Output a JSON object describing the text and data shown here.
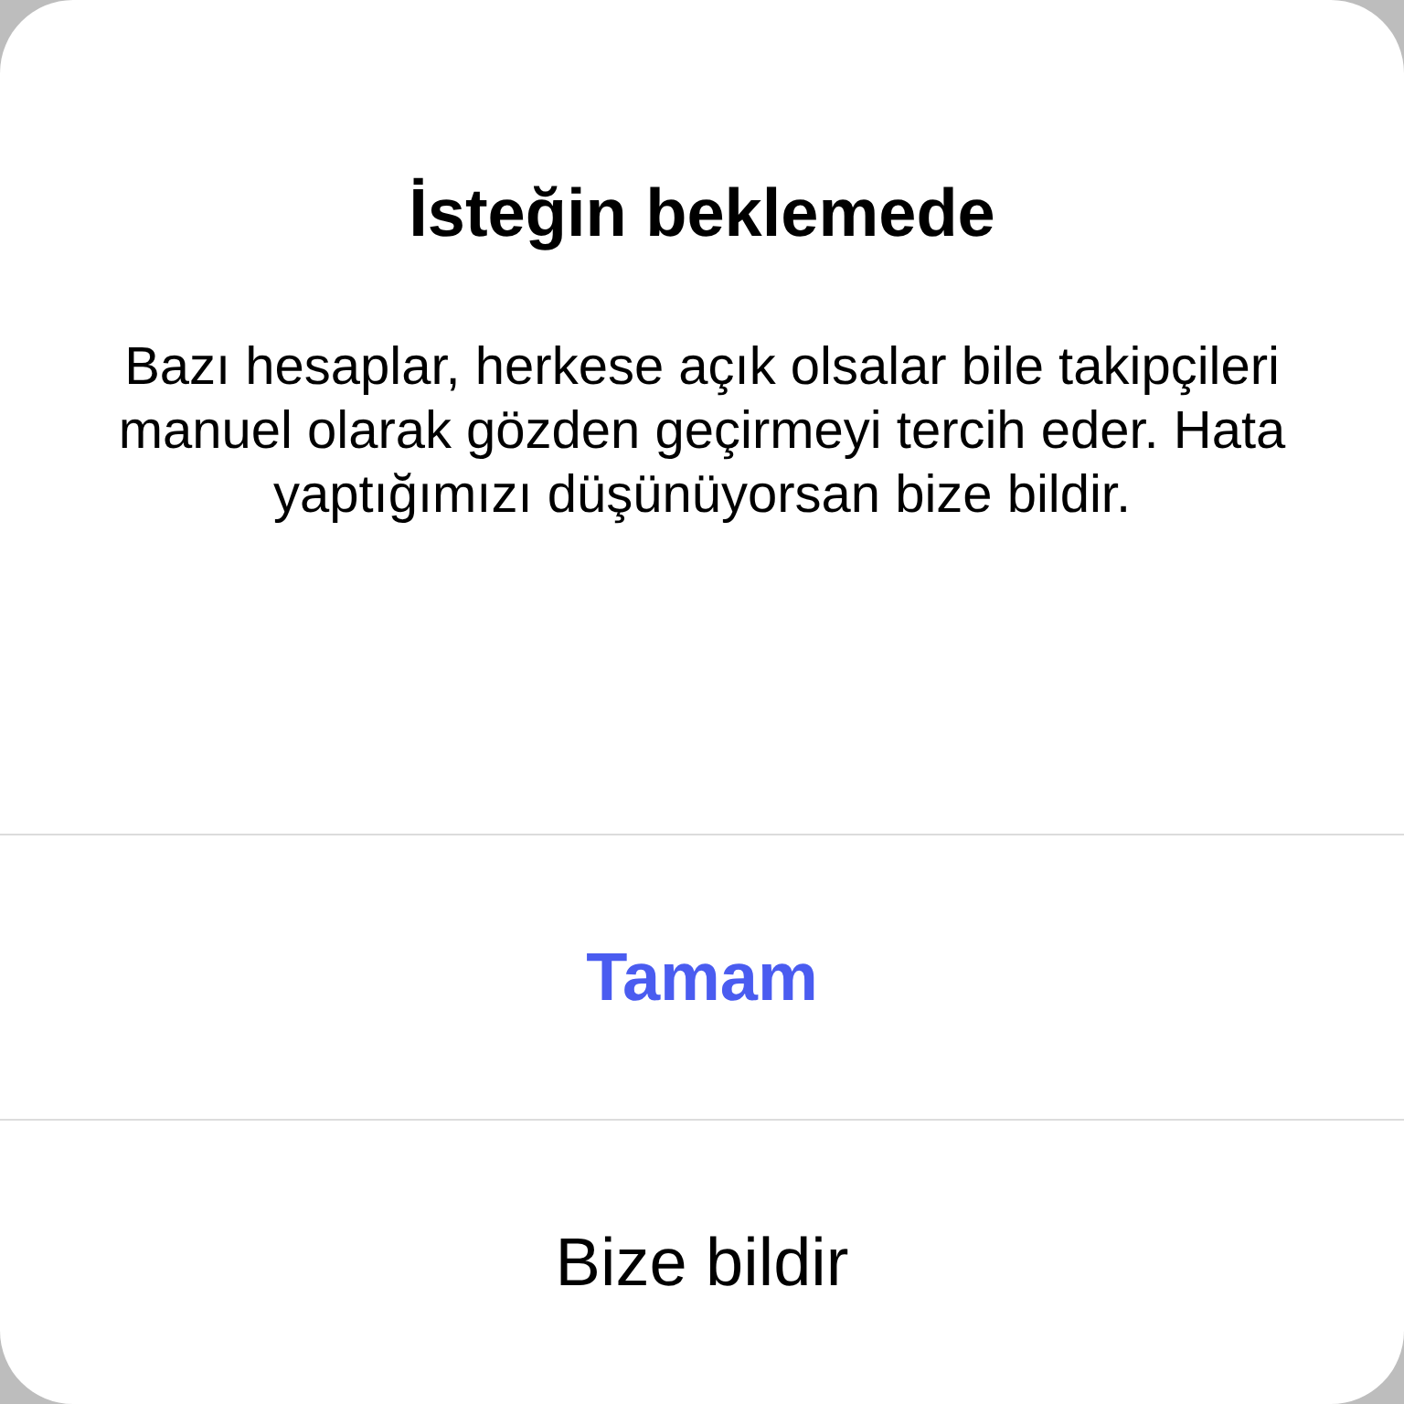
{
  "dialog": {
    "title": "İsteğin beklemede",
    "message": "Bazı hesaplar, herkese açık olsalar bile takipçileri manuel olarak gözden geçirmeyi tercih eder. Hata yaptığımızı düşünüyorsan bize bildir.",
    "buttons": [
      {
        "label": "Tamam",
        "kind": "primary"
      },
      {
        "label": "Bize bildir",
        "kind": "default"
      }
    ]
  }
}
